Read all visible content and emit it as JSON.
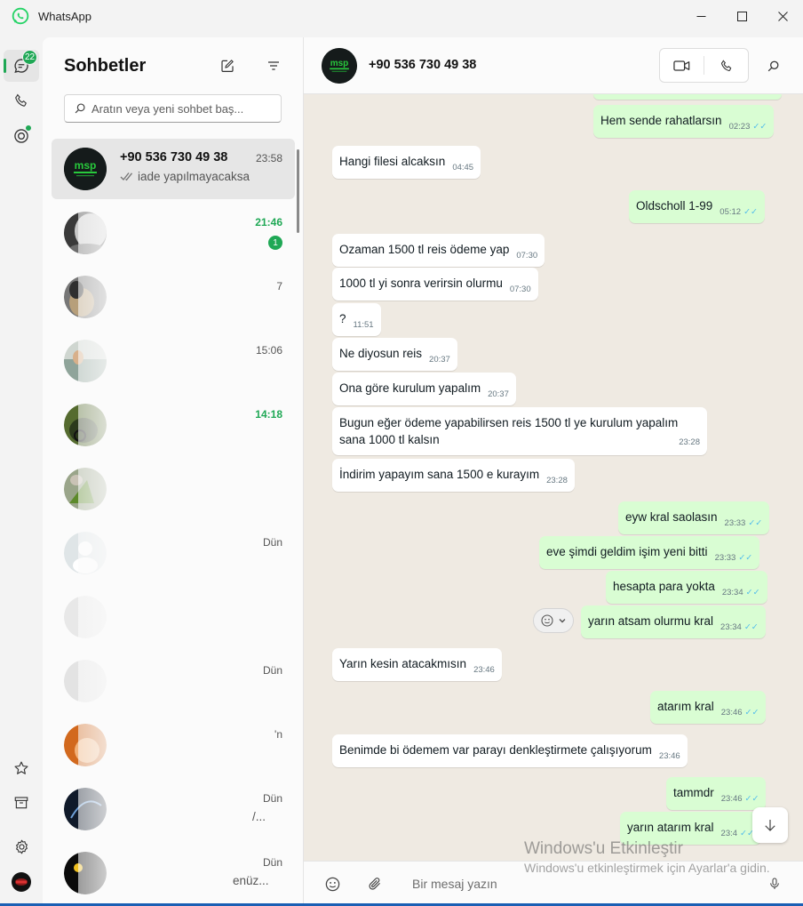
{
  "window": {
    "title": "WhatsApp",
    "controls": [
      "minimize",
      "maximize",
      "close"
    ]
  },
  "rail": {
    "chats_badge": "22",
    "icons": [
      "chat-icon",
      "phone-icon",
      "status-icon",
      "star-icon",
      "archive-icon",
      "gear-icon",
      "profile-avatar"
    ]
  },
  "chatlist": {
    "title": "Sohbetler",
    "search_placeholder": "Aratın veya yeni sohbet baş...",
    "rows": [
      {
        "name": "+90 536 730 49 38",
        "time": "23:58",
        "preview": "iade yapılmayacaksa",
        "selected": true
      },
      {
        "name": "",
        "time": "21:46",
        "time_green": true,
        "unread": "1"
      },
      {
        "name": "",
        "time": "7"
      },
      {
        "name": "",
        "time": "15:06"
      },
      {
        "name": "",
        "time": "14:18",
        "time_green": true
      },
      {
        "name": "",
        "time": "",
        "time_green": true
      },
      {
        "name": "",
        "time": "Dün"
      },
      {
        "name": "",
        "time": ""
      },
      {
        "name": "",
        "time": "Dün"
      },
      {
        "name": "",
        "time": "'n"
      },
      {
        "name": "",
        "time": "Dün",
        "preview_tail": "/..."
      },
      {
        "name": "",
        "time": "Dün",
        "preview_tail": "enüz..."
      }
    ]
  },
  "conversation": {
    "contact": "+90 536 730 49 38",
    "composer_placeholder": "Bir mesaj yazın",
    "messages": [
      {
        "dir": "out",
        "text": "Hem sende rahatlarsın",
        "time": "02:23",
        "read": true
      },
      {
        "dir": "in",
        "text": "Hangi filesi alcaksın",
        "time": "04:45"
      },
      {
        "dir": "out",
        "text": "Oldscholl 1-99",
        "time": "05:12",
        "read": true
      },
      {
        "dir": "in",
        "text": "Ozaman 1500 tl reis ödeme yap",
        "time": "07:30"
      },
      {
        "dir": "in",
        "text": "1000 tl yi sonra verirsin olurmu",
        "time": "07:30"
      },
      {
        "dir": "in",
        "text": "?",
        "time": "11:51"
      },
      {
        "dir": "in",
        "text": "Ne diyosun reis",
        "time": "20:37"
      },
      {
        "dir": "in",
        "text": "Ona göre kurulum yapalım",
        "time": "20:37"
      },
      {
        "dir": "in",
        "text": "Bugun eğer ödeme yapabilirsen reis 1500 tl ye kurulum yapalım sana 1000 tl kalsın",
        "time": "23:28"
      },
      {
        "dir": "in",
        "text": "İndirim yapayım sana 1500 e kurayım",
        "time": "23:28"
      },
      {
        "dir": "out",
        "text": "eyw kral saolasın",
        "time": "23:33",
        "read": true
      },
      {
        "dir": "out",
        "text": "eve şimdi geldim işim yeni bitti",
        "time": "23:33",
        "read": true
      },
      {
        "dir": "out",
        "text": "hesapta para yokta",
        "time": "23:34",
        "read": true
      },
      {
        "dir": "out",
        "text": "yarın atsam olurmu kral",
        "time": "23:34",
        "read": true
      },
      {
        "dir": "in",
        "text": "Yarın kesin atacakmısın",
        "time": "23:46"
      },
      {
        "dir": "out",
        "text": "atarım kral",
        "time": "23:46",
        "read": true
      },
      {
        "dir": "in",
        "text": "Benimde bi ödemem var parayı denkleştirmete çalışıyorum",
        "time": "23:46"
      },
      {
        "dir": "out",
        "text": "tammdr",
        "time": "23:46",
        "read": true
      },
      {
        "dir": "out",
        "text": "yarın atarım kral",
        "time": "23:4",
        "read": true
      }
    ]
  },
  "watermark": {
    "line1": "Windows'u Etkinleştir",
    "line2": "Windows'u etkinleştirmek için Ayarlar'a gidin."
  },
  "colors": {
    "accent": "#1fa855",
    "outgoing_bubble": "#d9fdd3",
    "read_tick": "#53bdeb",
    "chat_bg": "#efeae2"
  }
}
